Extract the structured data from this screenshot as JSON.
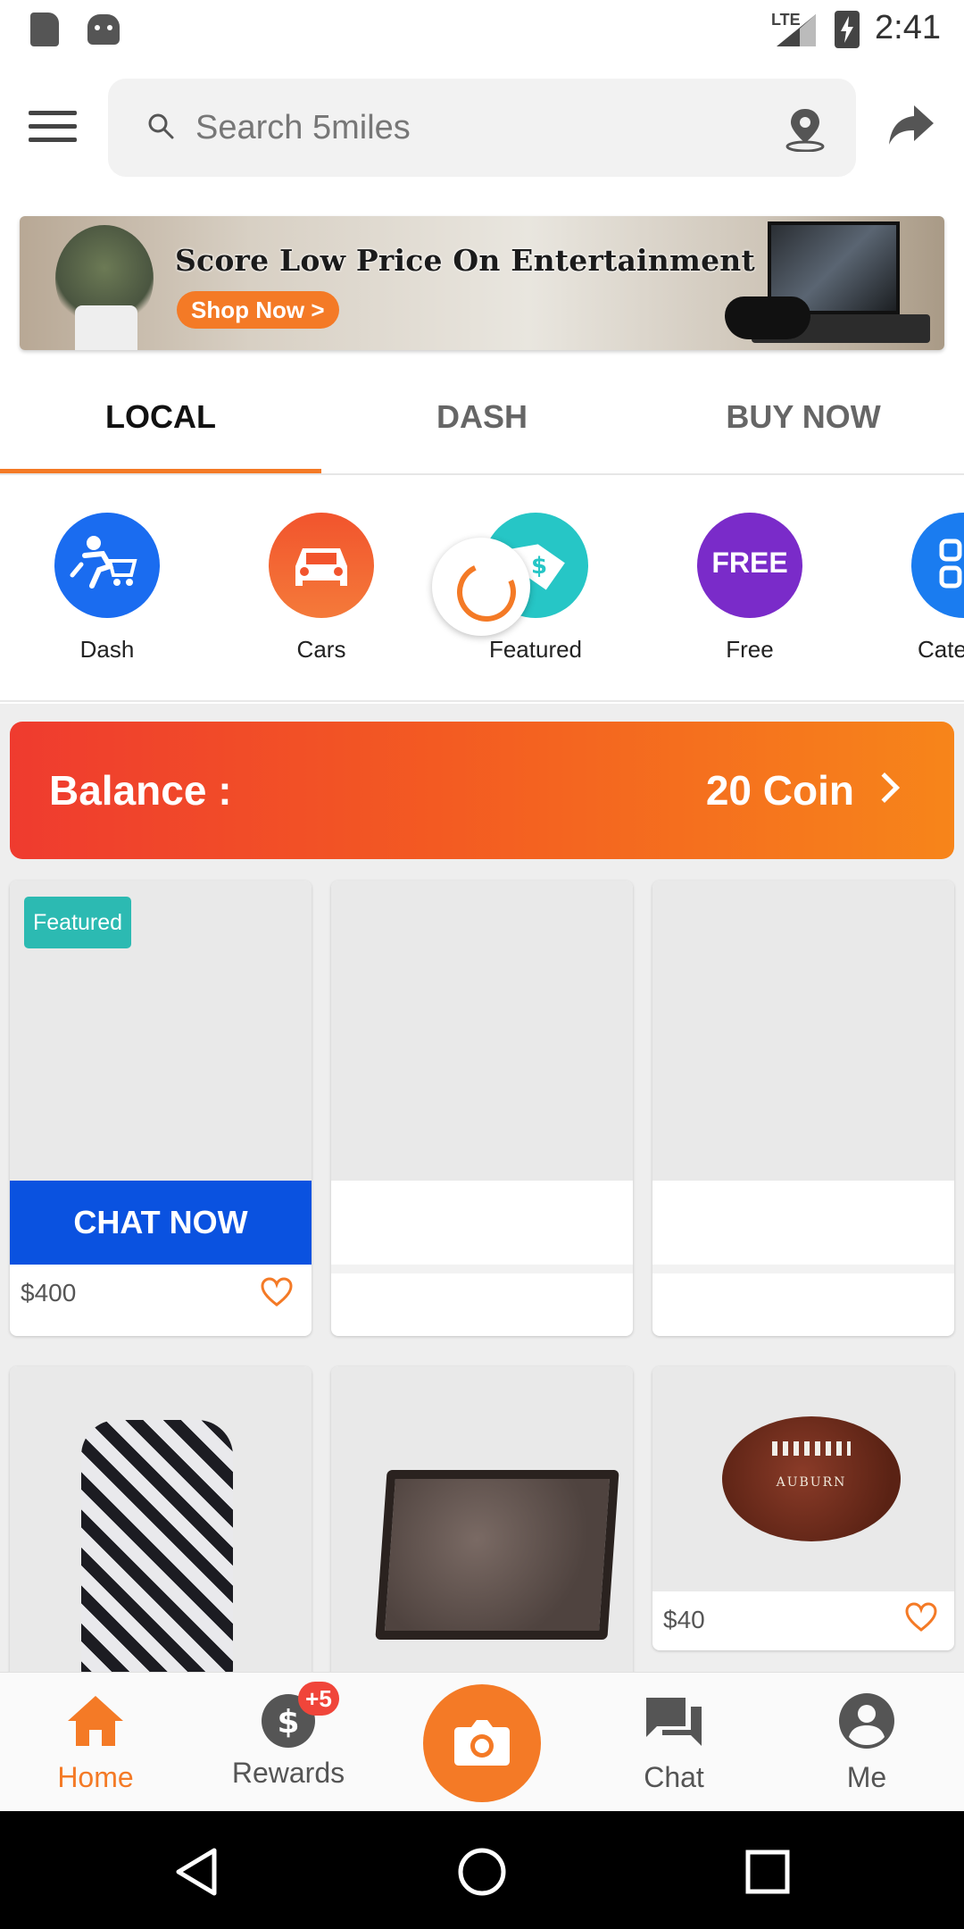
{
  "status_bar": {
    "network": "LTE",
    "time": "2:41"
  },
  "header": {
    "search_placeholder": "Search 5miles"
  },
  "banner": {
    "headline": "Score Low Price On Entertainment",
    "cta": "Shop Now >"
  },
  "tabs": [
    {
      "label": "LOCAL",
      "active": true
    },
    {
      "label": "DASH",
      "active": false
    },
    {
      "label": "BUY NOW",
      "active": false
    }
  ],
  "categories": [
    {
      "label": "Dash",
      "icon": "dash-cart-icon",
      "color": "#1a6cf0"
    },
    {
      "label": "Cars",
      "icon": "car-icon",
      "color": "#f2542d"
    },
    {
      "label": "Featured",
      "icon": "price-tag-icon",
      "color": "#26c6c6"
    },
    {
      "label": "Free",
      "icon": "free-icon",
      "badge_text": "FREE",
      "color": "#7a2bc9"
    },
    {
      "label": "Cate",
      "icon": "categories-icon",
      "color": "#1a7cf0"
    }
  ],
  "balance": {
    "label": "Balance :",
    "value": "20 Coin"
  },
  "products": [
    {
      "badge": "Featured",
      "cta": "CHAT NOW",
      "price": "$400"
    },
    {
      "price": ""
    },
    {
      "price": ""
    },
    {
      "image": "dress-photo"
    },
    {
      "image": "coffee-table-photo"
    },
    {
      "image": "football-photo",
      "brand": "AUBURN",
      "price": "$40"
    }
  ],
  "bottom_nav": [
    {
      "label": "Home",
      "icon": "home-icon",
      "active": true
    },
    {
      "label": "Rewards",
      "icon": "dollar-icon",
      "badge": "+5",
      "active": false
    },
    {
      "label": "",
      "icon": "camera-icon",
      "active": false
    },
    {
      "label": "Chat",
      "icon": "chat-icon",
      "active": false
    },
    {
      "label": "Me",
      "icon": "person-icon",
      "active": false
    }
  ],
  "colors": {
    "accent": "#f47a26",
    "chat_now": "#0a52e0",
    "featured_badge": "#2cbab2"
  }
}
